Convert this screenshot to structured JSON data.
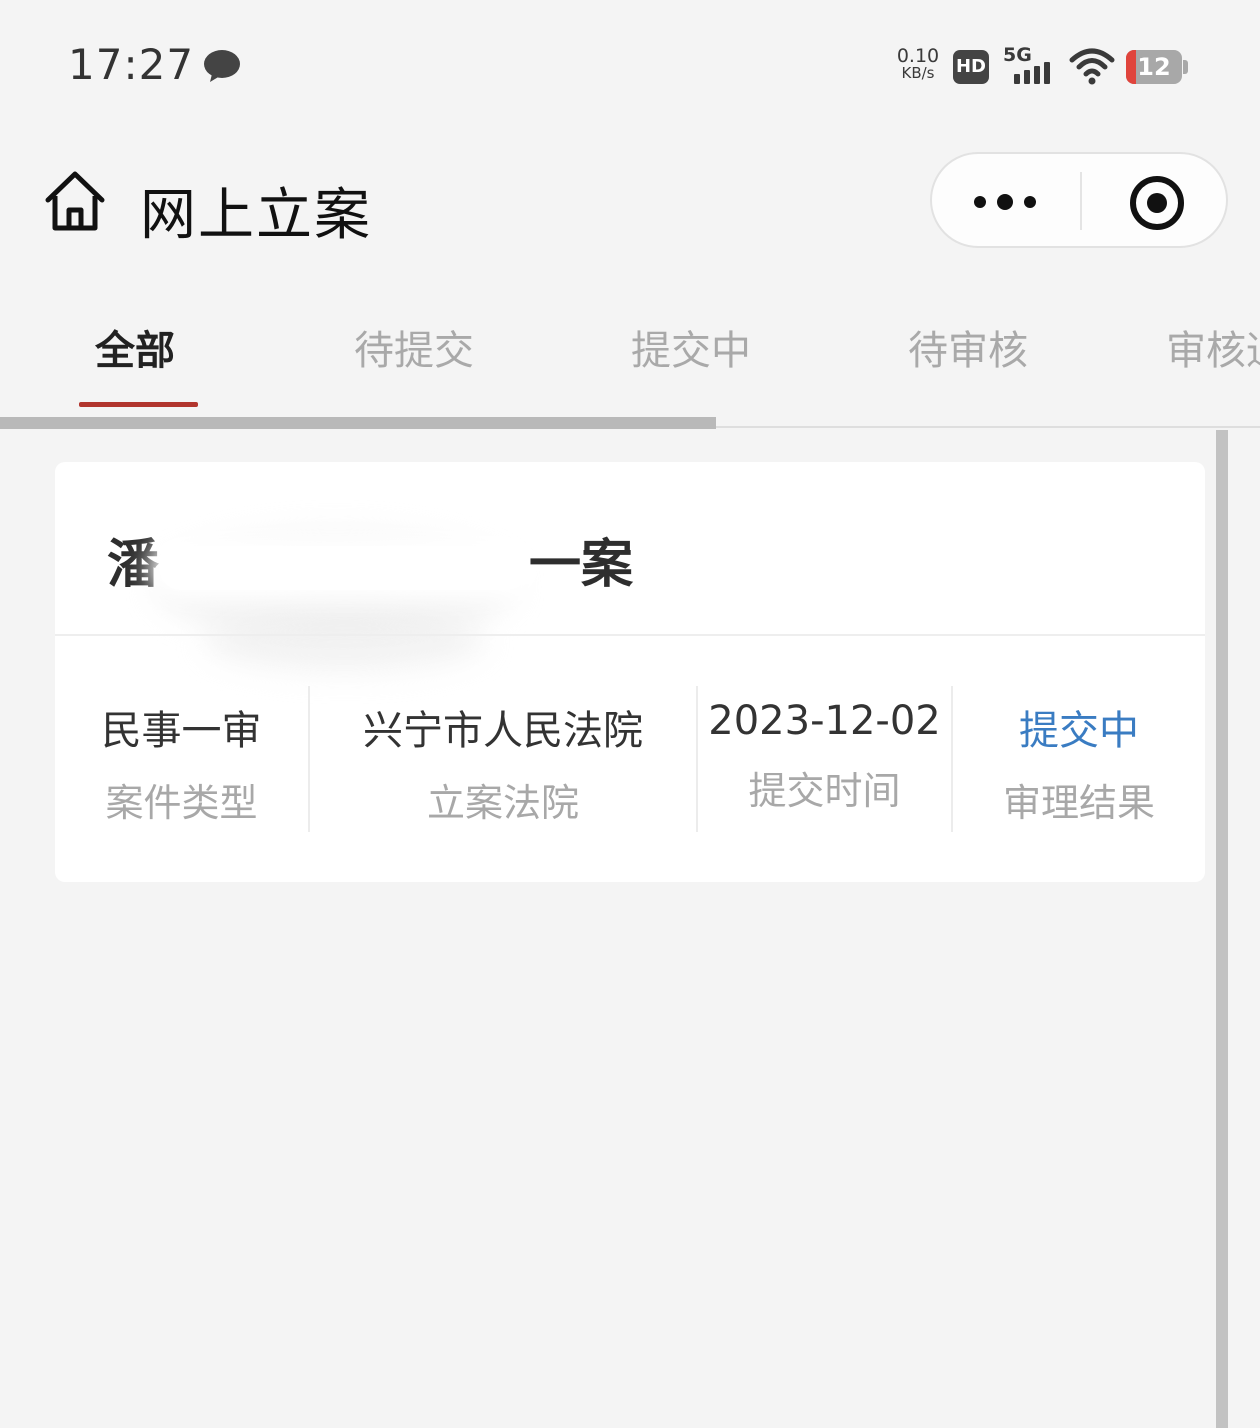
{
  "status_bar": {
    "time": "17:27",
    "net_speed_value": "0.10",
    "net_speed_unit": "KB/s",
    "hd_label": "HD",
    "network_label": "5G",
    "battery_level": "12",
    "icons": [
      "message-icon",
      "hd-icon",
      "signal-icon",
      "wifi-icon",
      "battery-icon"
    ]
  },
  "nav": {
    "title": "网上立案",
    "icons": [
      "home-icon",
      "more-icon",
      "target-icon"
    ]
  },
  "tabs": [
    {
      "label": "全部",
      "active": true
    },
    {
      "label": "待提交",
      "active": false
    },
    {
      "label": "提交中",
      "active": false
    },
    {
      "label": "待审核",
      "active": false
    },
    {
      "label": "审核通",
      "active": false
    }
  ],
  "colors": {
    "accent": "#b1352d",
    "status_blue": "#3a7cc2",
    "background": "#f4f4f4"
  },
  "case_card": {
    "title_start": "潘",
    "title_end": "一案",
    "fields": [
      {
        "value": "民事一审",
        "label": "案件类型"
      },
      {
        "value": "兴宁市人民法院",
        "label": "立案法院"
      },
      {
        "value": "2023-12-02",
        "label": "提交时间"
      },
      {
        "value": "提交中",
        "label": "审理结果"
      }
    ]
  }
}
